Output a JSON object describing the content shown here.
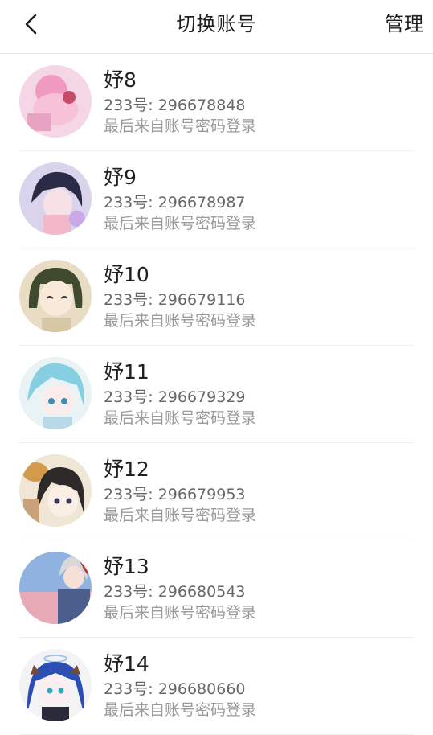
{
  "header": {
    "title": "切换账号",
    "manage_label": "管理"
  },
  "colors": {
    "background": "#ffffff",
    "title_text": "#1f1f1f",
    "uid_text": "#666666",
    "hint_text": "#9a9a9a",
    "divider": "#eeeeee"
  },
  "accounts": [
    {
      "name": "妤8",
      "uid": "233号: 296678848",
      "last_login": "最后来自账号密码登录",
      "avatar_icon": "anime-avatar-pink"
    },
    {
      "name": "妤9",
      "uid": "233号: 296678987",
      "last_login": "最后来自账号密码登录",
      "avatar_icon": "anime-avatar-dark-hair"
    },
    {
      "name": "妤10",
      "uid": "233号: 296679116",
      "last_login": "最后来自账号密码登录",
      "avatar_icon": "anime-avatar-bob-hair"
    },
    {
      "name": "妤11",
      "uid": "233号: 296679329",
      "last_login": "最后来自账号密码登录",
      "avatar_icon": "anime-avatar-cyan-hair"
    },
    {
      "name": "妤12",
      "uid": "233号: 296679953",
      "last_login": "最后来自账号密码登录",
      "avatar_icon": "anime-avatar-cat-girl"
    },
    {
      "name": "妤13",
      "uid": "233号: 296680543",
      "last_login": "最后来自账号密码登录",
      "avatar_icon": "anime-avatar-sky-boy"
    },
    {
      "name": "妤14",
      "uid": "233号: 296680660",
      "last_login": "最后来自账号密码登录",
      "avatar_icon": "anime-avatar-blue-hair"
    }
  ]
}
